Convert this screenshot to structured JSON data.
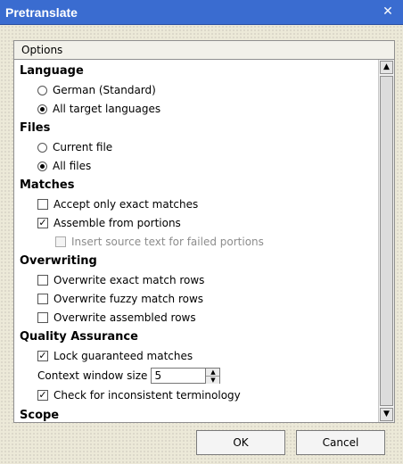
{
  "window": {
    "title": "Pretranslate",
    "close_glyph": "✕"
  },
  "options_label": "Options",
  "sections": {
    "language": {
      "title": "Language",
      "german": "German (Standard)",
      "all_targets": "All target languages"
    },
    "files": {
      "title": "Files",
      "current": "Current file",
      "all": "All files"
    },
    "matches": {
      "title": "Matches",
      "exact_only": "Accept only exact matches",
      "assemble": "Assemble from portions",
      "insert_source": "Insert source text for failed portions"
    },
    "overwriting": {
      "title": "Overwriting",
      "exact": "Overwrite exact match rows",
      "fuzzy": "Overwrite fuzzy match rows",
      "assembled": "Overwrite assembled rows"
    },
    "qa": {
      "title": "Quality Assurance",
      "lock": "Lock guaranteed matches",
      "context_label": "Context window size",
      "context_value": "5",
      "terminology": "Check for inconsistent terminology"
    },
    "scope": {
      "title": "Scope"
    }
  },
  "buttons": {
    "ok": "OK",
    "cancel": "Cancel"
  },
  "checks": {
    "checked_glyph": "✓"
  },
  "scroll": {
    "up_glyph": "▲",
    "down_glyph": "▼"
  },
  "spinner": {
    "up_glyph": "▲",
    "down_glyph": "▼"
  }
}
